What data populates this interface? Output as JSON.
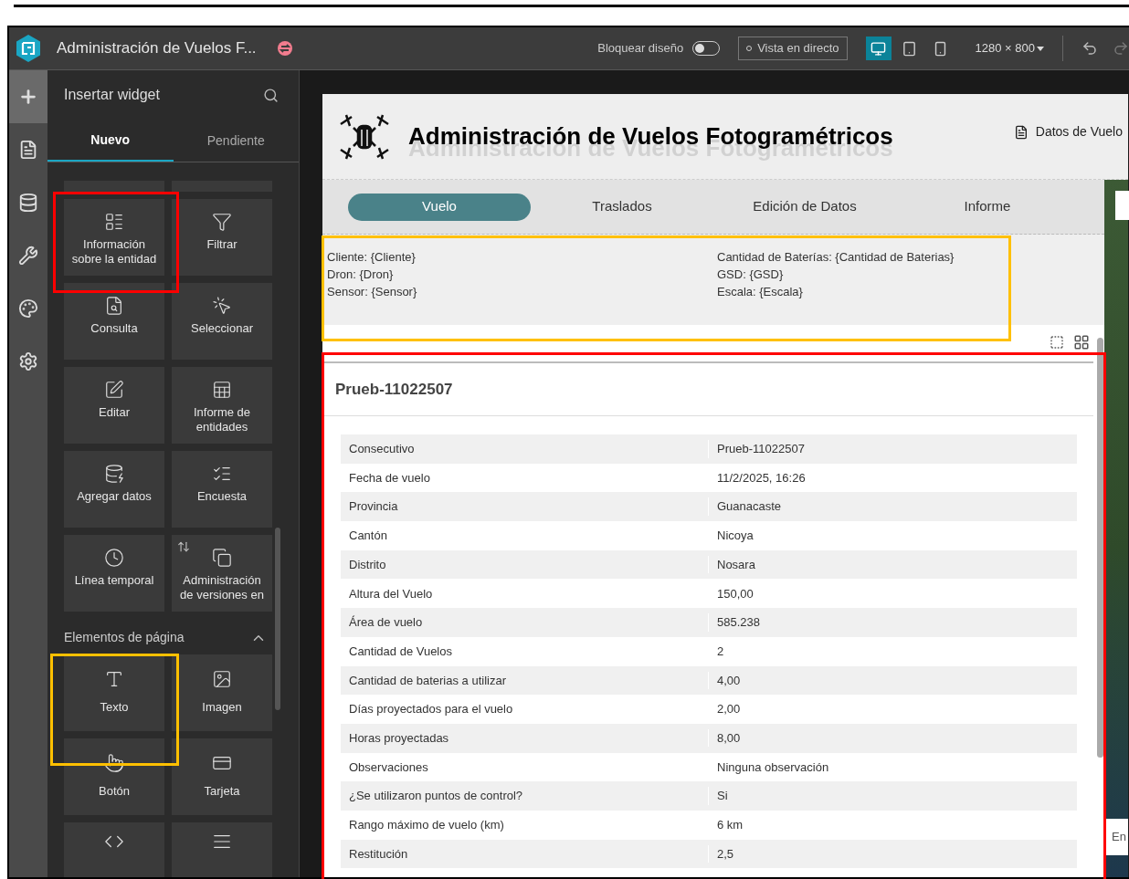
{
  "header": {
    "title": "Administración de Vuelos F...",
    "lock_label": "Bloquear diseño",
    "lock_on": false,
    "live_view": "Vista en directo",
    "devices": [
      {
        "selected": true
      },
      {
        "selected": false
      },
      {
        "selected": false
      }
    ],
    "resolution": "1280 × 800"
  },
  "rail": [
    {
      "selected": true
    },
    {
      "selected": false
    },
    {
      "selected": false
    },
    {
      "selected": false
    },
    {
      "selected": false
    },
    {
      "selected": false
    }
  ],
  "widget_panel": {
    "title": "Insertar widget",
    "tabs": [
      {
        "label": "Nuevo",
        "selected": true
      },
      {
        "label": "Pendiente",
        "selected": false
      }
    ],
    "widgets": [
      {
        "label": "Información sobre la entidad",
        "badge": false
      },
      {
        "label": "Filtrar",
        "badge": false
      },
      {
        "label": "Consulta",
        "badge": false
      },
      {
        "label": "Seleccionar",
        "badge": false
      },
      {
        "label": "Editar",
        "badge": false
      },
      {
        "label": "Informe de entidades",
        "badge": false
      },
      {
        "label": "Agregar datos",
        "badge": false
      },
      {
        "label": "Encuesta",
        "badge": false
      },
      {
        "label": "Línea temporal",
        "badge": false
      },
      {
        "label": "Administración de versiones en",
        "badge": true
      }
    ],
    "section": {
      "title": "Elementos de página",
      "expanded": true
    },
    "page_elements": [
      {
        "label": "Texto"
      },
      {
        "label": "Imagen"
      },
      {
        "label": "Botón"
      },
      {
        "label": "Tarjeta"
      }
    ]
  },
  "page": {
    "title": "Administración de Vuelos Fotogramétricos",
    "header_link": "Datos de Vuelo",
    "tabs": [
      {
        "label": "Vuelo",
        "selected": true
      },
      {
        "label": "Traslados",
        "selected": false
      },
      {
        "label": "Edición de Datos",
        "selected": false
      },
      {
        "label": "Informe",
        "selected": false
      }
    ],
    "info_left": [
      "Cliente: {Cliente}",
      "Dron: {Dron}",
      "Sensor: {Sensor}"
    ],
    "info_right": [
      "Cantidad de Baterías: {Cantidad de Baterias}",
      "GSD: {GSD}",
      "Escala: {Escala}"
    ],
    "feature_title": "Prueb-11022507",
    "rows": [
      [
        "Consecutivo",
        "Prueb-11022507"
      ],
      [
        "Fecha de vuelo",
        "11/2/2025, 16:26"
      ],
      [
        "Provincia",
        "Guanacaste"
      ],
      [
        "Cantón",
        "Nicoya"
      ],
      [
        "Distrito",
        "Nosara"
      ],
      [
        "Altura del Vuelo",
        "150,00"
      ],
      [
        "Área de vuelo",
        "585.238"
      ],
      [
        "Cantidad de Vuelos",
        "2"
      ],
      [
        "Cantidad de baterias a utilizar",
        "4,00"
      ],
      [
        "Días proyectados para el vuelo",
        "2,00"
      ],
      [
        "Horas proyectadas",
        "8,00"
      ],
      [
        "Observaciones",
        "Ninguna observación"
      ],
      [
        "¿Se utilizaron puntos de control?",
        "Si"
      ],
      [
        "Rango máximo de vuelo (km)",
        "6 km"
      ],
      [
        "Restitución",
        "2,5"
      ]
    ],
    "map_text": "En"
  },
  "highlights": [
    {
      "color": "#ff0000"
    },
    {
      "color": "#ffc000"
    },
    {
      "color": "#ffc000"
    },
    {
      "color": "#ff0000"
    }
  ]
}
